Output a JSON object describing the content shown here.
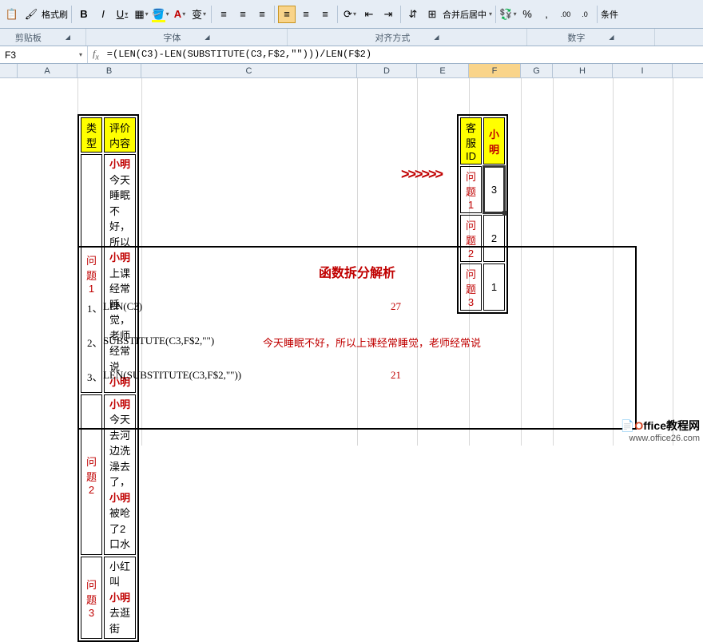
{
  "ribbon": {
    "format_painter": "格式刷",
    "merge_center": "合并后居中",
    "conditional": "条件"
  },
  "groups": {
    "clipboard": "剪贴板",
    "font": "字体",
    "align": "对齐方式",
    "number": "数字"
  },
  "namebox": "F3",
  "formula": "=(LEN(C3)-LEN(SUBSTITUTE(C3,F$2,\"\")))/LEN(F$2)",
  "cols": [
    "A",
    "B",
    "C",
    "D",
    "E",
    "F",
    "G",
    "H",
    "I"
  ],
  "table1": {
    "h1": "类型",
    "h2": "评价内容",
    "rows": [
      {
        "label": "问题1",
        "pre1": "",
        "kw1": "小明",
        "mid1": "今天睡眠不好，所以",
        "kw2": "小明",
        "mid2": "上课经常睡觉，老师经常说",
        "kw3": "小明",
        "post": ""
      },
      {
        "label": "问题2",
        "pre1": "",
        "kw1": "小明",
        "mid1": "今天去河边洗澡去了，",
        "kw2": "小明",
        "mid2": "被呛了2口水",
        "kw3": "",
        "post": ""
      },
      {
        "label": "问题3",
        "pre1": "小红叫",
        "kw1": "小明",
        "mid1": "去逛街",
        "kw2": "",
        "mid2": "",
        "kw3": "",
        "post": ""
      }
    ]
  },
  "arrows": ">>>>>>",
  "table2": {
    "h1": "客服ID",
    "h2": "小明",
    "rows": [
      {
        "label": "问题1",
        "val": "3"
      },
      {
        "label": "问题2",
        "val": "2"
      },
      {
        "label": "问题3",
        "val": "1"
      }
    ]
  },
  "analysis": {
    "title": "函数拆分解析",
    "r1_n": "1、",
    "r1_f": "LEN(C3)",
    "r1_r": "27",
    "r2_n": "2、",
    "r2_f": "SUBSTITUTE(C3,F$2,\"\")",
    "r2_r": "今天睡眠不好，所以上课经常睡觉，老师经常说",
    "r3_n": "3、",
    "r3_f": "LEN(SUBSTITUTE(C3,F$2,\"\"))",
    "r3_r": "21"
  },
  "watermark": {
    "brand_o": "O",
    "brand_rest": "ffice教程网",
    "url": "www.office26.com"
  }
}
